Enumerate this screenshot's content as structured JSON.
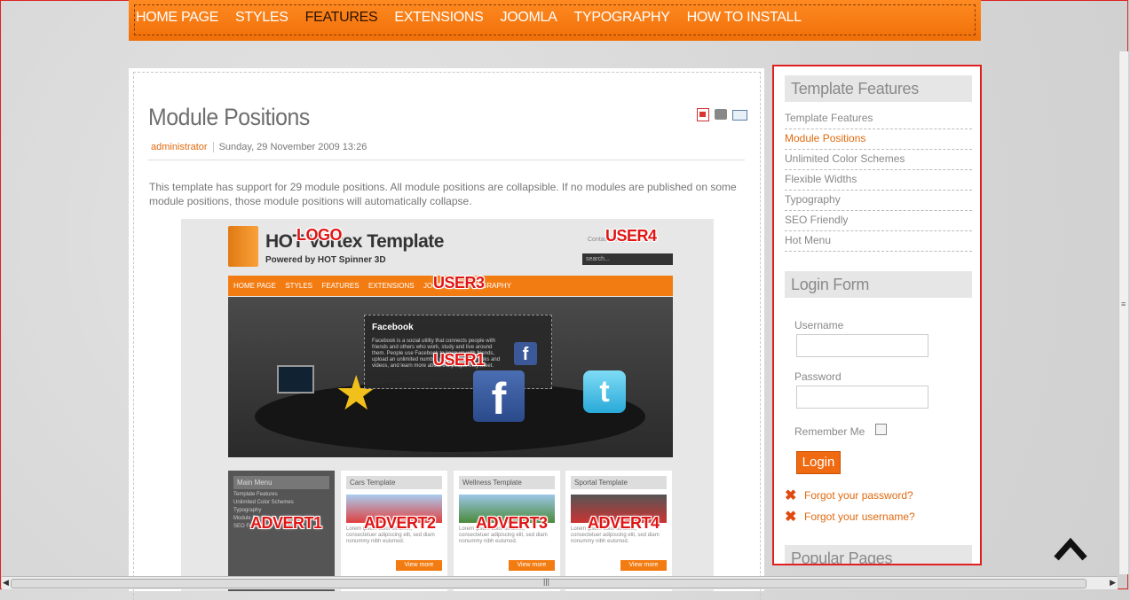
{
  "nav": {
    "items": [
      "HOME PAGE",
      "STYLES",
      "FEATURES",
      "EXTENSIONS",
      "JOOMLA",
      "TYPOGRAPHY",
      "HOW TO INSTALL"
    ],
    "active": "FEATURES"
  },
  "article": {
    "title": "Module Positions",
    "author": "administrator",
    "date": "Sunday, 29 November 2009 13:26",
    "body": "This template has support for 29 module positions. All module positions are collapsible. If no modules are published on some module positions, those module positions will automatically collapse.",
    "icons": [
      "pdf-icon",
      "print-icon",
      "email-icon"
    ],
    "preview": {
      "logo_text": "HOT Vortex Template",
      "powered": "Powered by HOT Spinner 3D",
      "top_links": "Contact   |   Login",
      "search": "search...",
      "nav": [
        "HOME PAGE",
        "STYLES",
        "FEATURES",
        "EXTENSIONS",
        "JOOMLA",
        "TYPOGRAPHY"
      ],
      "fb_title": "Facebook",
      "fb_text": "Facebook is a social utility that connects people with friends and others who work, study and live around them. People use Facebook to keep up with friends, upload an unlimited number of photos, share links and videos, and learn more about the people they meet.",
      "main_menu_title": "Main Menu",
      "main_menu_items": [
        "Template Features",
        "Unlimited Color Schemes",
        "Typography",
        "Module Positions",
        "SEO Friendly"
      ],
      "cols": [
        {
          "title": "Cars Template",
          "lorem": "Lorem ipsum dolor sit amet, consectetuer adipiscing elit, sed diam nonummy nibh euismod.",
          "more": "View more"
        },
        {
          "title": "Wellness Template",
          "lorem": "Lorem ipsum dolor sit amet, consectetuer adipiscing elit, sed diam nonummy nibh euismod.",
          "more": "View more"
        },
        {
          "title": "Sportal Template",
          "lorem": "Lorem ipsum dolor sit amet, consectetuer adipiscing elit, sed diam nonummy nibh euismod.",
          "more": "View more"
        }
      ],
      "labels": {
        "logo": "LOGO",
        "user4": "USER4",
        "user3": "USER3",
        "user1": "USER1",
        "advert1": "ADVERT1",
        "advert2": "ADVERT2",
        "advert3": "ADVERT3",
        "advert4": "ADVERT4"
      }
    }
  },
  "sidebar": {
    "features_title": "Template Features",
    "features": [
      "Template Features",
      "Module Positions",
      "Unlimited Color Schemes",
      "Flexible Widths",
      "Typography",
      "SEO Friendly",
      "Hot Menu"
    ],
    "active_feature": "Module Positions",
    "login": {
      "title": "Login Form",
      "username_label": "Username",
      "password_label": "Password",
      "remember_label": "Remember Me",
      "button": "Login",
      "forgot_password": "Forgot your password?",
      "forgot_username": "Forgot your username?"
    },
    "popular_title": "Popular Pages"
  },
  "colors": {
    "accent": "#f37c12",
    "highlight": "#e02020",
    "link": "#e06a10"
  }
}
